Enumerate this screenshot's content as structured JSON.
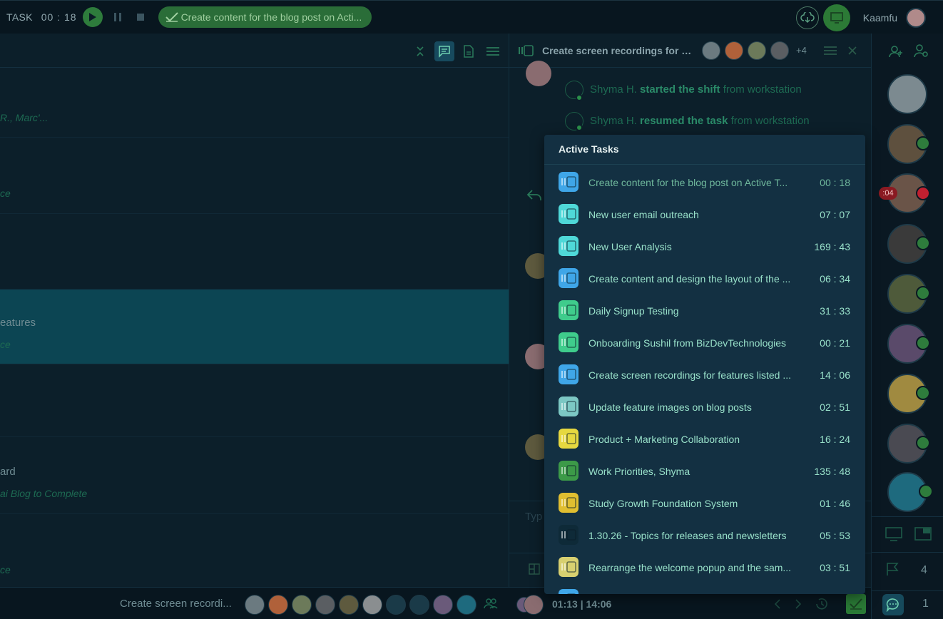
{
  "topbar": {
    "task_label": "TASK",
    "timer": "00 : 18",
    "current_task": "Create content for the blog post on Acti...",
    "user_name": "Kaamfu"
  },
  "left_pane": {
    "rows": [
      {
        "line1": "",
        "line2": "R., Marc'..."
      },
      {
        "line1": "",
        "line2": "ce"
      },
      {
        "line1": "eatures",
        "line2": "ce"
      },
      {
        "line1": "ard",
        "line2": "ai Blog to Complete"
      },
      {
        "line1": "",
        "line2": "ce"
      }
    ]
  },
  "chat": {
    "title": "Create screen recordings for fe...",
    "extra_members": "+4",
    "feed": [
      {
        "user": "Shyma H.",
        "action": "started the shift",
        "suffix": "from workstation"
      },
      {
        "user": "Shyma H.",
        "action": "resumed the task",
        "suffix": "from workstation"
      }
    ],
    "input_placeholder": "Typ"
  },
  "active_tasks": {
    "title": "Active Tasks",
    "items": [
      {
        "name": "Create content for the blog post on Active T...",
        "time": "00 : 18",
        "color": "#3fa6e8"
      },
      {
        "name": "New user email outreach",
        "time": "07 : 07",
        "color": "#4fd8d8"
      },
      {
        "name": "New User Analysis",
        "time": "169 : 43",
        "color": "#4fd8d8"
      },
      {
        "name": "Create content and design the layout of the ...",
        "time": "06 : 34",
        "color": "#3fa6e8"
      },
      {
        "name": "Daily Signup Testing",
        "time": "31 : 33",
        "color": "#3fcc8c"
      },
      {
        "name": "Onboarding Sushil from BizDevTechnologies",
        "time": "00 : 21",
        "color": "#3fcc8c"
      },
      {
        "name": "Create screen recordings for features listed ...",
        "time": "14 : 06",
        "color": "#3fa6e8"
      },
      {
        "name": "Update feature images on blog posts",
        "time": "02 : 51",
        "color": "#7cc8c4"
      },
      {
        "name": "Product + Marketing Collaboration",
        "time": "16 : 24",
        "color": "#e6d840"
      },
      {
        "name": "Work Priorities, Shyma",
        "time": "135 : 48",
        "color": "#3c9a48"
      },
      {
        "name": "Study Growth Foundation System",
        "time": "01 : 46",
        "color": "#e0be30"
      },
      {
        "name": "1.30.26 - Topics for releases and newsletters",
        "time": "05 : 53",
        "color": "#0e2a38"
      },
      {
        "name": "Rearrange the welcome popup and the sam...",
        "time": "03 : 51",
        "color": "#d8d070"
      },
      {
        "name": "",
        "time": "",
        "color": "#3fa6e8"
      }
    ]
  },
  "bottom_bar": {
    "task_title": "Create screen recordi...",
    "time": "01:13 | 14:06"
  },
  "right_rail": {
    "badge_time": ":04",
    "flag_count": "4",
    "chat_count": "1"
  }
}
